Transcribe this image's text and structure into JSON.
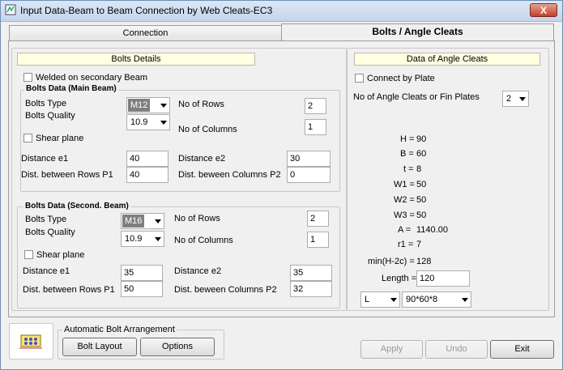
{
  "window": {
    "title": "Input Data-Beam to Beam Connection by Web Cleats-EC3",
    "close_label": "X"
  },
  "tabs": [
    {
      "label": "Connection"
    },
    {
      "label": "Bolts / Angle Cleats"
    }
  ],
  "left": {
    "header": "Bolts Details",
    "welded_label": "Welded on secondary Beam",
    "main": {
      "title": "Bolts Data (Main Beam)",
      "bolts_type_label": "Bolts Type",
      "bolts_type_value": "M12",
      "bolts_quality_label": "Bolts Quality",
      "bolts_quality_value": "10.9",
      "rows_label": "No of Rows",
      "rows_value": "2",
      "cols_label": "No of Columns",
      "cols_value": "1",
      "shear_label": "Shear plane",
      "e1_label": "Distance e1",
      "e1_value": "40",
      "e2_label": "Distance e2",
      "e2_value": "30",
      "p1_label": "Dist. between Rows P1",
      "p1_value": "40",
      "p2_label": "Dist. beween Columns P2",
      "p2_value": "0"
    },
    "second": {
      "title": "Bolts Data (Second. Beam)",
      "bolts_type_label": "Bolts Type",
      "bolts_type_value": "M16",
      "bolts_quality_label": "Bolts Quality",
      "bolts_quality_value": "10.9",
      "rows_label": "No of Rows",
      "rows_value": "2",
      "cols_label": "No of Columns",
      "cols_value": "1",
      "shear_label": "Shear plane",
      "e1_label": "Distance e1",
      "e1_value": "35",
      "e2_label": "Distance e2",
      "e2_value": "35",
      "p1_label": "Dist. between Rows P1",
      "p1_value": "50",
      "p2_label": "Dist. beween Columns P2",
      "p2_value": "32"
    }
  },
  "right": {
    "header": "Data of Angle Cleats",
    "connect_label": "Connect by Plate",
    "num_cleats_label": "No of Angle Cleats or Fin Plates",
    "num_cleats_value": "2",
    "props": [
      {
        "label": "H =",
        "value": "90"
      },
      {
        "label": "B =",
        "value": "60"
      },
      {
        "label": "t =",
        "value": "8"
      },
      {
        "label": "W1 =",
        "value": "50"
      },
      {
        "label": "W2 =",
        "value": "50"
      },
      {
        "label": "W3 =",
        "value": "50"
      },
      {
        "label": "A =",
        "value": "1140.00"
      },
      {
        "label": "r1 =",
        "value": "7"
      }
    ],
    "minh_label": "min(H-2c) =",
    "minh_value": "128",
    "length_label": "Length =",
    "length_value": "120",
    "shape_value": "L",
    "section_value": "90*60*8"
  },
  "bottom": {
    "group_label": "Automatic Bolt Arrangement",
    "bolt_layout_label": "Bolt Layout",
    "options_label": "Options",
    "apply_label": "Apply",
    "undo_label": "Undo",
    "exit_label": "Exit"
  }
}
